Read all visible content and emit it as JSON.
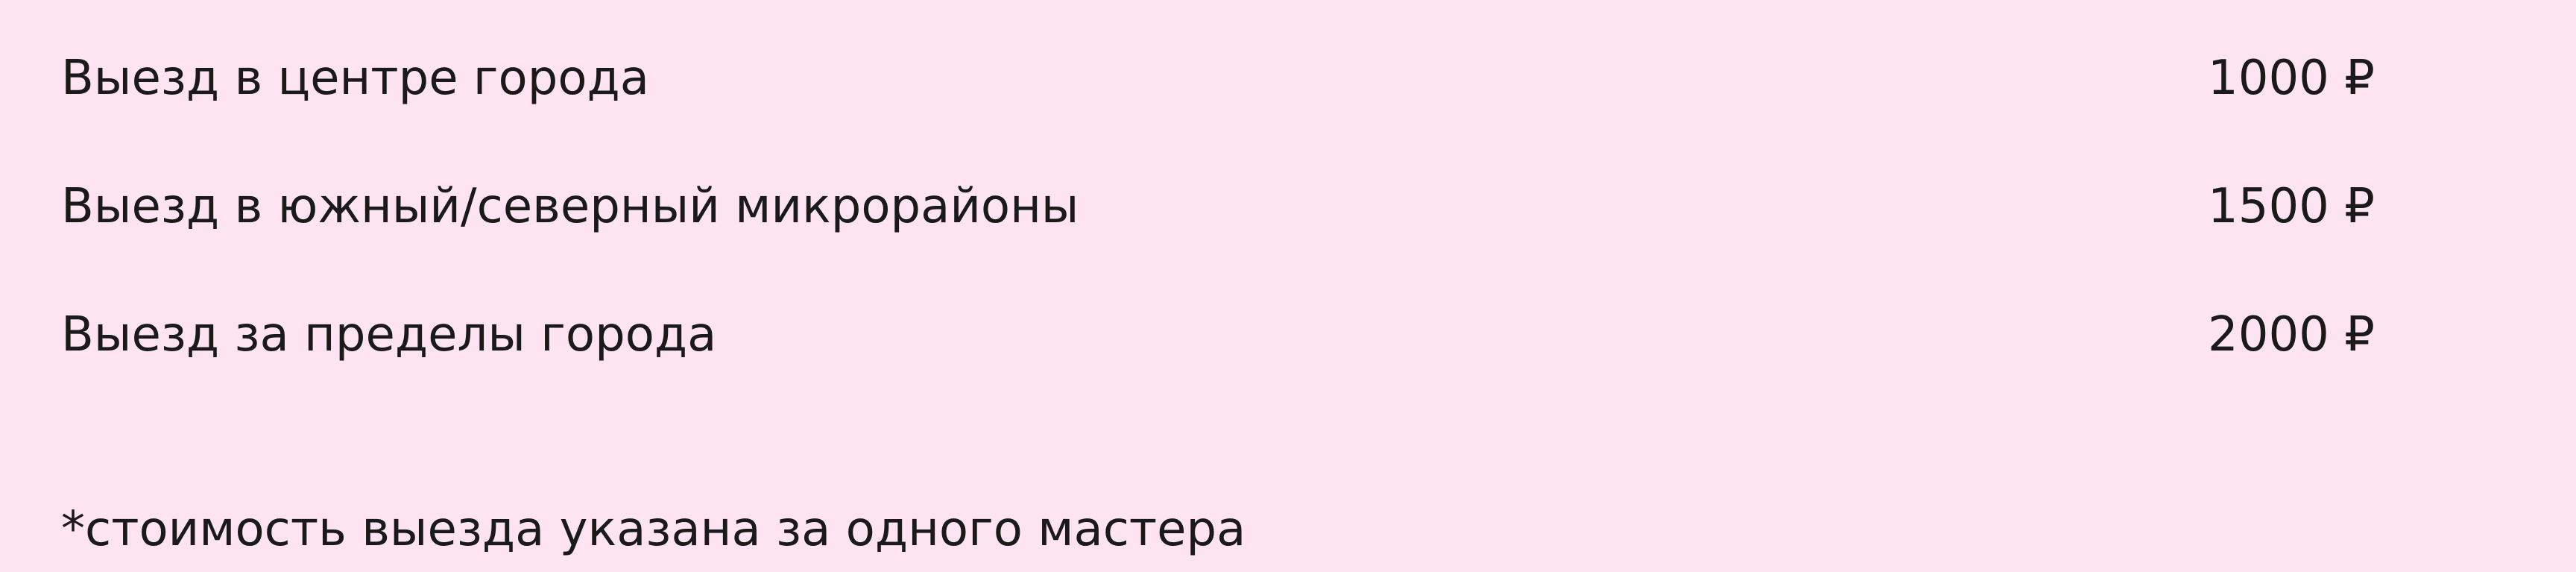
{
  "price_list": {
    "items": [
      {
        "label": "Выезд в центре города",
        "price": "1000 ₽"
      },
      {
        "label": "Выезд в южный/северный микрорайоны",
        "price": "1500 ₽"
      },
      {
        "label": "Выезд за пределы города",
        "price": "2000 ₽"
      }
    ],
    "footnote": "*стоимость выезда указана за одного мастера"
  }
}
